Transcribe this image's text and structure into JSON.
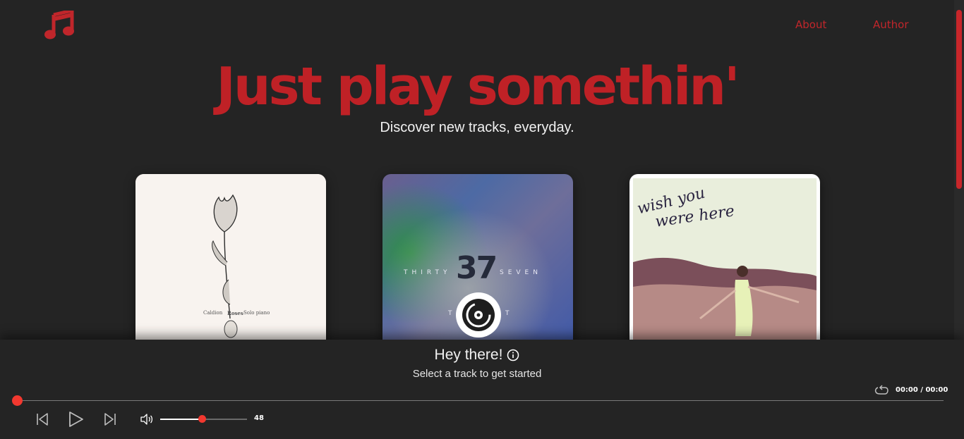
{
  "header": {
    "logo_icon": "music-note-icon",
    "nav": [
      {
        "label": "About"
      },
      {
        "label": "Author"
      }
    ]
  },
  "hero": {
    "title": "Just play somethin'",
    "subtitle": "Discover new tracks, everyday."
  },
  "albums": [
    {
      "cover_text": [
        "Caldion",
        "Roses",
        "Solo piano"
      ]
    },
    {
      "cover_text": [
        "THIRTY",
        "37",
        "SEVEN",
        "T",
        "T"
      ]
    },
    {
      "cover_text": [
        "wish you",
        "were here"
      ]
    }
  ],
  "player": {
    "heading": "Hey there!",
    "subheading": "Select a track to get started",
    "time": "00:00 / 00:00",
    "progress": 0,
    "volume": 48,
    "volume_label": "48",
    "accent_color": "#f2382f",
    "brand_color": "#c0262b"
  }
}
